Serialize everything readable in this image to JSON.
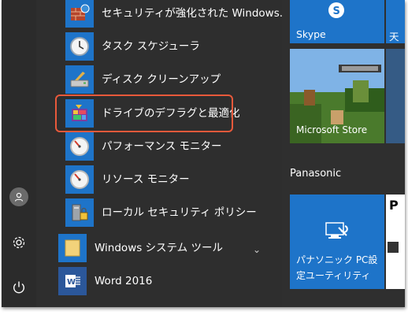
{
  "rail": {
    "avatar_icon": "user-icon",
    "settings_icon": "gear-icon",
    "power_icon": "power-icon"
  },
  "app_list": {
    "items": [
      {
        "label": "セキュリティが強化された Windows...",
        "icon": "firewall-icon"
      },
      {
        "label": "タスク スケジューラ",
        "icon": "clock-icon"
      },
      {
        "label": "ディスク クリーンアップ",
        "icon": "disk-cleanup-icon"
      },
      {
        "label": "ドライブのデフラグと最適化",
        "icon": "defrag-icon"
      },
      {
        "label": "パフォーマンス モニター",
        "icon": "gauge-icon"
      },
      {
        "label": "リソース モニター",
        "icon": "gauge-icon"
      },
      {
        "label": "ローカル セキュリティ ポリシー",
        "icon": "security-policy-icon"
      },
      {
        "label": "Windows システム ツール",
        "icon": "folder-icon"
      },
      {
        "label": "Word 2016",
        "icon": "word-icon"
      }
    ],
    "highlight_color": "#e8593b",
    "tile_color": "#1e74c9"
  },
  "tiles": {
    "skype": {
      "label": "Skype",
      "color": "#1e74c9"
    },
    "partial_top": {
      "label": "天"
    },
    "store": {
      "label": "Microsoft Store"
    },
    "group_label": "Panasonic",
    "panasonic_pc": {
      "label": "パナソニック PC設定ユーティリティ",
      "line1": "パナソニック PC設",
      "line2": "定ユーティリティ",
      "color": "#1e74c9"
    },
    "partial_bottom": {
      "label": "P"
    }
  }
}
